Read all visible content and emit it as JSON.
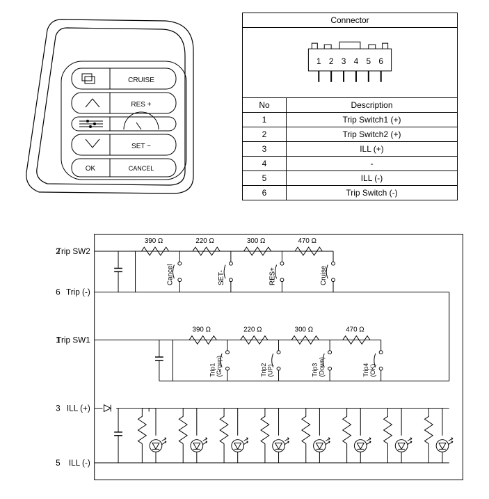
{
  "steering": {
    "btn_cruise": "CRUISE",
    "btn_res": "RES +",
    "btn_set": "SET −",
    "btn_ok": "OK",
    "btn_cancel": "CANCEL"
  },
  "connector": {
    "title": "Connector",
    "pins": [
      "1",
      "2",
      "3",
      "4",
      "5",
      "6"
    ],
    "header_no": "No",
    "header_desc": "Description",
    "rows": [
      {
        "no": "1",
        "desc": "Trip Switch1 (+)"
      },
      {
        "no": "2",
        "desc": "Trip Switch2 (+)"
      },
      {
        "no": "3",
        "desc": "ILL (+)"
      },
      {
        "no": "4",
        "desc": "-"
      },
      {
        "no": "5",
        "desc": "ILL (-)"
      },
      {
        "no": "6",
        "desc": "Trip Switch (-)"
      }
    ]
  },
  "circuit": {
    "pin2_label": "Trip SW2",
    "pin2_no": "2",
    "pin6_label": "Trip (-)",
    "pin6_no": "6",
    "pin1_label": "Trip SW1",
    "pin1_no": "1",
    "pin3_label": "ILL (+)",
    "pin3_no": "3",
    "pin5_label": "ILL (-)",
    "pin5_no": "5",
    "sw2": {
      "r1": "390 Ω",
      "r2": "220 Ω",
      "r3": "300 Ω",
      "r4": "470 Ω",
      "s1": "Cancel",
      "s2": "SET-",
      "s3": "RES+",
      "s4": "Cruise"
    },
    "sw1": {
      "r1": "390 Ω",
      "r2": "220 Ω",
      "r3": "300 Ω",
      "r4": "470 Ω",
      "s1a": "Trip1",
      "s1b": "(Group)",
      "s2a": "Trip2",
      "s2b": "(UP)",
      "s3a": "Trip3",
      "s3b": "(Down)",
      "s4a": "Trip4",
      "s4b": "(OK)"
    }
  }
}
